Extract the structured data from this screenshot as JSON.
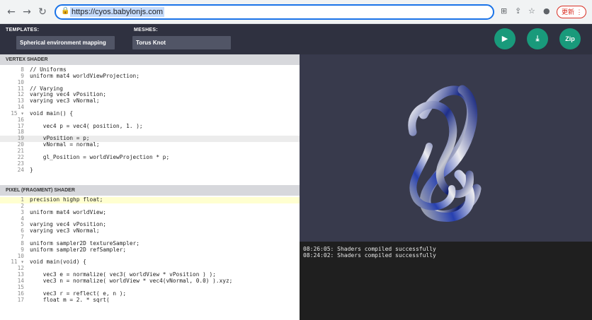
{
  "browser": {
    "url": "https://cyos.babylonjs.com",
    "update_label": "更新 ⋮"
  },
  "header": {
    "templates_label": "TEMPLATES:",
    "templates_value": "Spherical environment mapping",
    "meshes_label": "MESHES:",
    "meshes_value": "Torus Knot",
    "zip_label": "Zip"
  },
  "vertex": {
    "title": "VERTEX SHADER",
    "lines": [
      {
        "n": "8",
        "t": "// Uniforms"
      },
      {
        "n": "9",
        "t": "uniform mat4 worldViewProjection;"
      },
      {
        "n": "10",
        "t": ""
      },
      {
        "n": "11",
        "t": "// Varying"
      },
      {
        "n": "12",
        "t": "varying vec4 vPosition;"
      },
      {
        "n": "13",
        "t": "varying vec3 vNormal;"
      },
      {
        "n": "14",
        "t": ""
      },
      {
        "n": "15 ▾",
        "t": "void main() {"
      },
      {
        "n": "16",
        "t": ""
      },
      {
        "n": "17",
        "t": "    vec4 p = vec4( position, 1. );"
      },
      {
        "n": "18",
        "t": ""
      },
      {
        "n": "19",
        "t": "    vPosition = p;"
      },
      {
        "n": "20",
        "t": "    vNormal = normal;"
      },
      {
        "n": "21",
        "t": ""
      },
      {
        "n": "22",
        "t": "    gl_Position = worldViewProjection * p;"
      },
      {
        "n": "23",
        "t": ""
      },
      {
        "n": "24",
        "t": "}"
      }
    ]
  },
  "fragment": {
    "title": "PIXEL (FRAGMENT) SHADER",
    "lines": [
      {
        "n": "1",
        "t": "precision highp float;"
      },
      {
        "n": "2",
        "t": ""
      },
      {
        "n": "3",
        "t": "uniform mat4 worldView;"
      },
      {
        "n": "4",
        "t": ""
      },
      {
        "n": "5",
        "t": "varying vec4 vPosition;"
      },
      {
        "n": "6",
        "t": "varying vec3 vNormal;"
      },
      {
        "n": "7",
        "t": ""
      },
      {
        "n": "8",
        "t": "uniform sampler2D textureSampler;"
      },
      {
        "n": "9",
        "t": "uniform sampler2D refSampler;"
      },
      {
        "n": "10",
        "t": ""
      },
      {
        "n": "11 ▾",
        "t": "void main(void) {"
      },
      {
        "n": "12",
        "t": ""
      },
      {
        "n": "13",
        "t": "    vec3 e = normalize( vec3( worldView * vPosition ) );"
      },
      {
        "n": "14",
        "t": "    vec3 n = normalize( worldView * vec4(vNormal, 0.0) ).xyz;"
      },
      {
        "n": "15",
        "t": ""
      },
      {
        "n": "16",
        "t": "    vec3 r = reflect( e, n );"
      },
      {
        "n": "17",
        "t": "    float m = 2. * sqrt("
      }
    ]
  },
  "console": {
    "lines": [
      "08:26:05: Shaders compiled successfully",
      "08:24:02: Shaders compiled successfully"
    ]
  },
  "colors": {
    "accent": "#199a7b",
    "header_bg": "#2f3140",
    "viewport_bg": "#383a4c",
    "console_bg": "#1f1f1f"
  },
  "icons": {
    "back": "arrow-left-icon",
    "forward": "arrow-right-icon",
    "reload": "reload-icon",
    "lock": "lock-icon",
    "translate": "translate-icon",
    "share": "share-icon",
    "bookmark": "star-icon",
    "profile": "profile-icon",
    "run": "play-icon",
    "download": "download-icon"
  }
}
